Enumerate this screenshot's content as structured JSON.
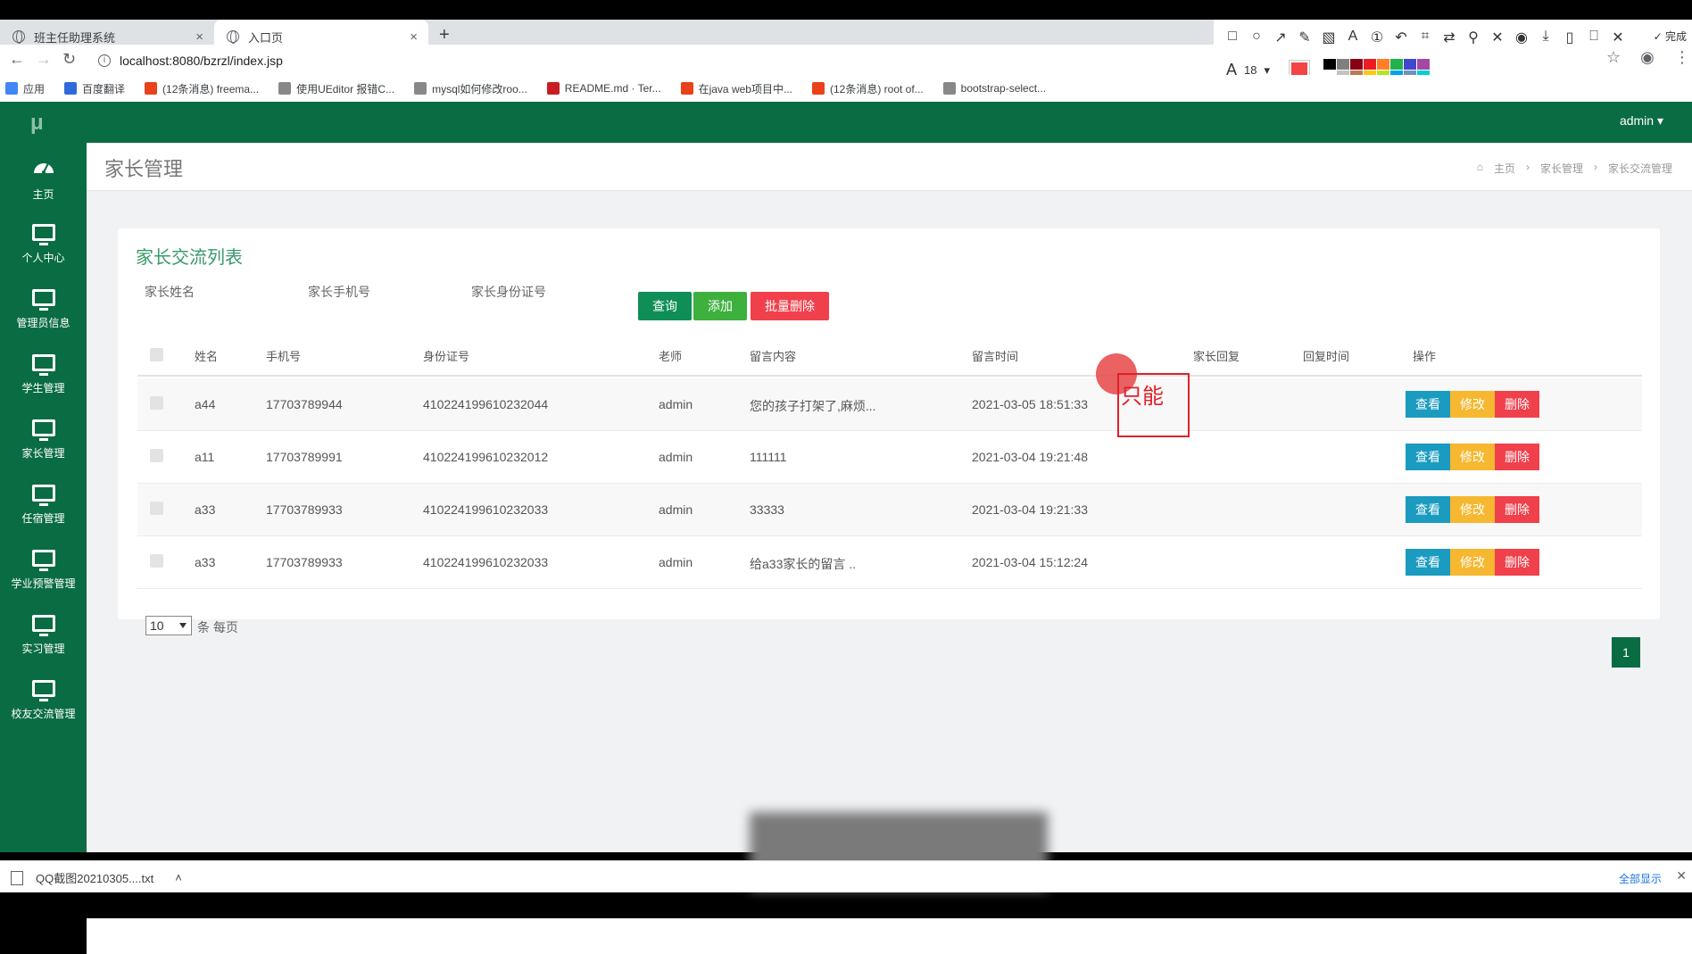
{
  "browser": {
    "tabs": [
      {
        "label": "班主任助理系统",
        "active": false
      },
      {
        "label": "入口页",
        "active": true
      }
    ],
    "url": "localhost:8080/bzrzl/index.jsp",
    "bookmarks": [
      {
        "label": "应用",
        "icon": "apps-grid-icon"
      },
      {
        "label": "百度翻译",
        "icon": "baidu-translate-icon"
      },
      {
        "label": "(12条消息) freema...",
        "icon": "csdn-icon"
      },
      {
        "label": "使用UEditor 报错C...",
        "icon": "page-icon"
      },
      {
        "label": "mysql如何修改roo...",
        "icon": "page-icon"
      },
      {
        "label": "README.md · Ter...",
        "icon": "gitee-icon"
      },
      {
        "label": "在java web项目中...",
        "icon": "csdn-icon"
      },
      {
        "label": "(12条消息) root of...",
        "icon": "csdn-icon"
      },
      {
        "label": "bootstrap-select...",
        "icon": "page-icon"
      }
    ]
  },
  "annotation_toolbar": {
    "done_label": "完成",
    "font_size": "18",
    "current_color": "#f44444",
    "swatches": [
      "#000000",
      "#7f7f7f",
      "#880015",
      "#ed1c24",
      "#ff7f27",
      "#22b14c",
      "#3f48cc",
      "#a349a4",
      "#ffffff",
      "#c3c3c3",
      "#b97a57",
      "#ffc90e",
      "#b5e61d",
      "#00a2e8",
      "#7092be",
      "#00d0d0"
    ]
  },
  "app": {
    "logo": "μ",
    "user_menu": "admin ▾",
    "sidebar": [
      {
        "label": "主页",
        "icon": "dashboard-gauge-icon"
      },
      {
        "label": "个人中心",
        "icon": "monitor-icon"
      },
      {
        "label": "管理员信息",
        "icon": "monitor-icon"
      },
      {
        "label": "学生管理",
        "icon": "monitor-icon"
      },
      {
        "label": "家长管理",
        "icon": "monitor-icon"
      },
      {
        "label": "任宿管理",
        "icon": "monitor-icon"
      },
      {
        "label": "学业预警管理",
        "icon": "monitor-icon"
      },
      {
        "label": "实习管理",
        "icon": "monitor-icon"
      },
      {
        "label": "校友交流管理",
        "icon": "monitor-icon"
      }
    ],
    "page_title": "家长管理",
    "breadcrumb": [
      "主页",
      "家长管理",
      "家长交流管理"
    ],
    "card_title": "家长交流列表",
    "search_fields": [
      "家长姓名",
      "家长手机号",
      "家长身份证号"
    ],
    "buttons": {
      "query": "查询",
      "add": "添加",
      "batch_delete": "批量删除"
    },
    "table": {
      "headers": [
        "姓名",
        "手机号",
        "身份证号",
        "老师",
        "留言内容",
        "留言时间",
        "家长回复",
        "回复时间",
        "操作"
      ],
      "rows": [
        {
          "name": "a44",
          "phone": "17703789944",
          "id_card": "410224199610232044",
          "teacher": "admin",
          "message": "您的孩子打架了,麻烦...",
          "time": "2021-03-05 18:51:33",
          "reply": "",
          "reply_time": ""
        },
        {
          "name": "a11",
          "phone": "17703789991",
          "id_card": "410224199610232012",
          "teacher": "admin",
          "message": "111111",
          "time": "2021-03-04 19:21:48",
          "reply": "",
          "reply_time": ""
        },
        {
          "name": "a33",
          "phone": "17703789933",
          "id_card": "410224199610232033",
          "teacher": "admin",
          "message": "33333",
          "time": "2021-03-04 19:21:33",
          "reply": "",
          "reply_time": ""
        },
        {
          "name": "a33",
          "phone": "17703789933",
          "id_card": "410224199610232033",
          "teacher": "admin",
          "message": "给a33家长的留言 ..",
          "time": "2021-03-04 15:12:24",
          "reply": "",
          "reply_time": ""
        }
      ],
      "row_actions": {
        "view": "查看",
        "edit": "修改",
        "delete": "删除"
      }
    },
    "page_size": "10",
    "per_page_label": "条 每页",
    "current_page": "1"
  },
  "annotation_overlay_text": "只能",
  "downloads": {
    "file": "QQ截图20210305....txt",
    "show_all": "全部显示"
  }
}
